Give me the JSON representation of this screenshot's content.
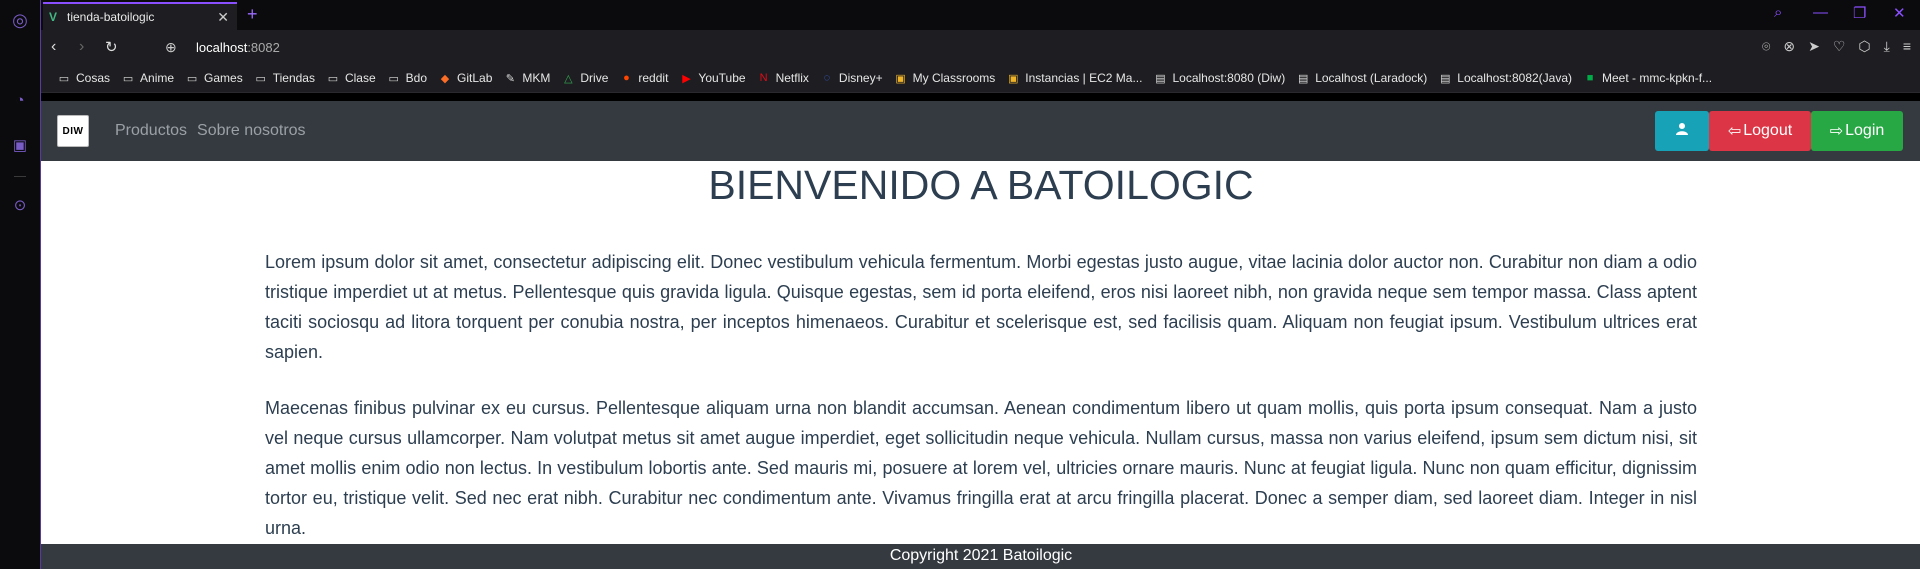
{
  "browser": {
    "tab_title": "tienda-batoilogic",
    "tab_close": "✕",
    "new_tab": "+",
    "url_host": "localhost",
    "url_port": ":8082"
  },
  "bookmarks": [
    {
      "label": "Cosas",
      "icon": "folder-icon"
    },
    {
      "label": "Anime",
      "icon": "folder-icon"
    },
    {
      "label": "Games",
      "icon": "folder-icon"
    },
    {
      "label": "Tiendas",
      "icon": "folder-icon"
    },
    {
      "label": "Clase",
      "icon": "folder-icon"
    },
    {
      "label": "Bdo",
      "icon": "folder-icon"
    },
    {
      "label": "GitLab",
      "icon": "gitlab-icon"
    },
    {
      "label": "MKM",
      "icon": "mkm-icon"
    },
    {
      "label": "Drive",
      "icon": "drive-icon"
    },
    {
      "label": "reddit",
      "icon": "reddit-icon"
    },
    {
      "label": "YouTube",
      "icon": "youtube-icon"
    },
    {
      "label": "Netflix",
      "icon": "netflix-icon"
    },
    {
      "label": "Disney+",
      "icon": "disney-icon"
    },
    {
      "label": "My Classrooms",
      "icon": "box-icon"
    },
    {
      "label": "Instancias | EC2 Ma...",
      "icon": "box-icon"
    },
    {
      "label": "Localhost:8080 (Diw)",
      "icon": "page-icon"
    },
    {
      "label": "Localhost (Laradock)",
      "icon": "page-icon"
    },
    {
      "label": "Localhost:8082(Java)",
      "icon": "page-icon"
    },
    {
      "label": "Meet - mmc-kpkn-f...",
      "icon": "meet-icon"
    }
  ],
  "site": {
    "brand": "DIW",
    "nav": [
      "Productos",
      "Sobre nosotros"
    ],
    "logout_label": "Logout",
    "login_label": "Login",
    "title": "BIENVENIDO A BATOILOGIC",
    "paragraph1": "Lorem ipsum dolor sit amet, consectetur adipiscing elit. Donec vestibulum vehicula fermentum. Morbi egestas justo augue, vitae lacinia dolor auctor non. Curabitur non diam a odio tristique imperdiet ut at metus. Pellentesque quis gravida ligula. Quisque egestas, sem id porta eleifend, eros nisi laoreet nibh, non gravida neque sem tempor massa. Class aptent taciti sociosqu ad litora torquent per conubia nostra, per inceptos himenaeos. Curabitur et scelerisque est, sed facilisis quam. Aliquam non feugiat ipsum. Vestibulum ultrices erat sapien.",
    "paragraph2": "Maecenas finibus pulvinar ex eu cursus. Pellentesque aliquam urna non blandit accumsan. Aenean condimentum libero ut quam mollis, quis porta ipsum consequat. Nam a justo vel neque cursus ullamcorper. Nam volutpat metus sit amet augue imperdiet, eget sollicitudin neque vehicula. Nullam cursus, massa non varius eleifend, ipsum sem dictum nisi, sit amet mollis enim odio non lectus. In vestibulum lobortis ante. Sed mauris mi, posuere at lorem vel, ultricies ornare mauris. Nunc at feugiat ligula. Nunc non quam efficitur, dignissim tortor eu, tristique velit. Sed nec erat nibh. Curabitur nec condimentum ante. Vivamus fringilla erat at arcu fringilla placerat. Donec a semper diam, sed laoreet diam. Integer in nisl urna.",
    "footer": "Copyright 2021 Batoilogic"
  },
  "colors": {
    "navbar": "#343a40",
    "info": "#17a2b8",
    "danger": "#dc3545",
    "success": "#28a745",
    "text": "#2c3e50",
    "accent": "#8a4fff"
  }
}
